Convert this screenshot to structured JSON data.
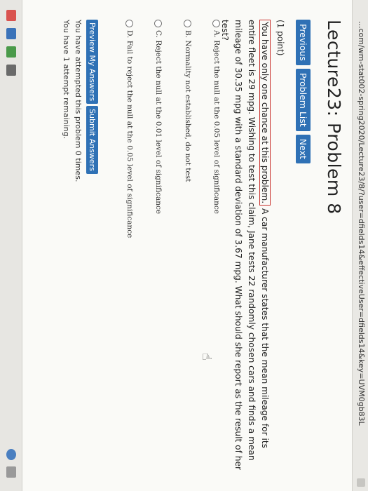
{
  "browser": {
    "url": "...com/wm-stat002-spring2020/Lecture23/8/?user=dfields14&effectiveUser=dfields14&key=UVM0gb83L"
  },
  "page": {
    "title": "Lecture23: Problem 8",
    "nav": {
      "previous": "Previous",
      "problem_list": "Problem List",
      "next": "Next"
    },
    "points": "(1 point)",
    "problem": {
      "highlight": "You have only one chance at this problem.",
      "text": " A car manufacturer states that the mean mileage for its entire fleet is 29 mpg. Wishing to test this claim, Jane tests 22 randomly chosen cars and finds a mean mileage of 30.35 mpg with a standard deviation of 3.67 mpg. What should she report as the result of her test?"
    },
    "options": [
      "A. Reject the null at the 0.05 level of significance",
      "B. Normality not established, do not test",
      "C. Reject the null at the 0.01 level of significance",
      "D. Fail to reject the null at the 0.05 level of significance"
    ],
    "actions": {
      "preview": "Preview My Answers",
      "submit": "Submit Answers"
    },
    "status": {
      "attempted": "You have attempted this problem 0 times.",
      "remaining": "You have 1 attempt remaining."
    }
  }
}
